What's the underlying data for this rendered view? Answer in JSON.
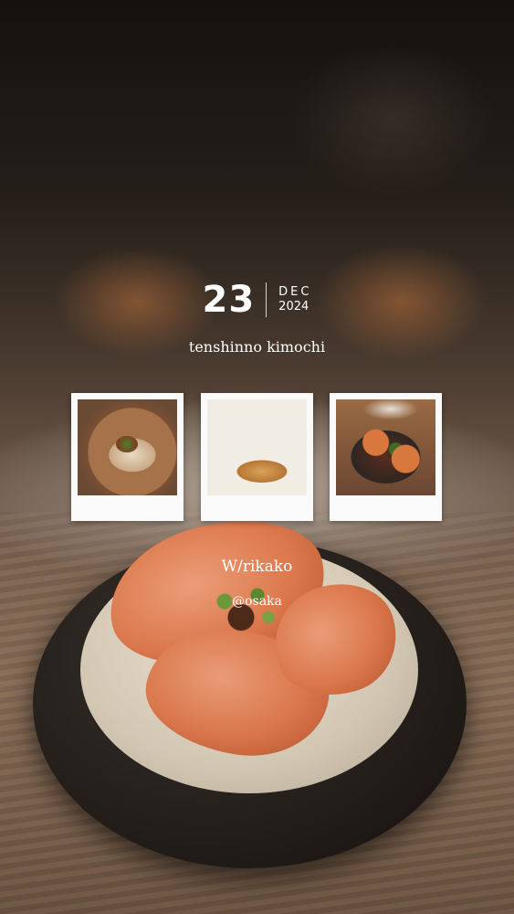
{
  "story": {
    "date": {
      "day": "23",
      "month": "DEC",
      "year": "2024"
    },
    "title": "tenshinno kimochi",
    "companion": "W/rikako",
    "location": "@osaka",
    "photos": [
      {
        "label": "dumplings in bamboo steamer"
      },
      {
        "label": "gyoza plate"
      },
      {
        "label": "fried dumplings in sauce"
      }
    ]
  }
}
